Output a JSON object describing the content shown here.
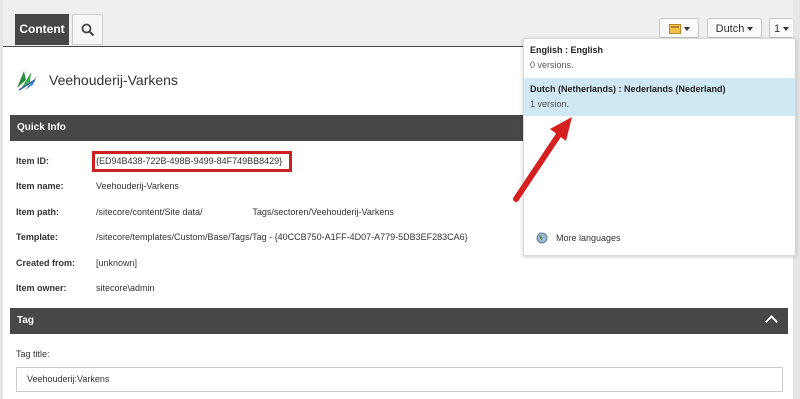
{
  "tabs": {
    "content_label": "Content"
  },
  "toolbar": {
    "language_label": "Dutch",
    "version_label": "1"
  },
  "item": {
    "title": "Veehouderij-Varkens"
  },
  "quick_info": {
    "header": "Quick Info",
    "fields": [
      {
        "label": "Item ID:",
        "value": "{ED94B438-722B-498B-9499-84F749BB8429}"
      },
      {
        "label": "Item name:",
        "value": "Veehouderij-Varkens"
      },
      {
        "label": "Item path:",
        "value": "/sitecore/content/Site data/                    Tags/sectoren/Veehouderij-Varkens"
      },
      {
        "label": "Template:",
        "value": "/sitecore/templates/Custom/Base/Tags/Tag - {40CCB750-A1FF-4D07-A779-5DB3EF283CA6}"
      },
      {
        "label": "Created from:",
        "value": "[unknown]"
      },
      {
        "label": "Item owner:",
        "value": "sitecore\\admin"
      }
    ]
  },
  "tag_section": {
    "header": "Tag",
    "field_label": "Tag title:",
    "field_value": "Veehouderij:Varkens"
  },
  "language_dropdown": {
    "items": [
      {
        "name": "English : English",
        "versions": "0 versions."
      },
      {
        "name": "Dutch (Netherlands) : Nederlands (Nederland)",
        "versions": "1 version."
      }
    ],
    "more_label": "More languages"
  },
  "colors": {
    "dark_bar": "#474747",
    "highlight_red": "#cc1f1f",
    "selected_row": "#d0e8f4"
  }
}
